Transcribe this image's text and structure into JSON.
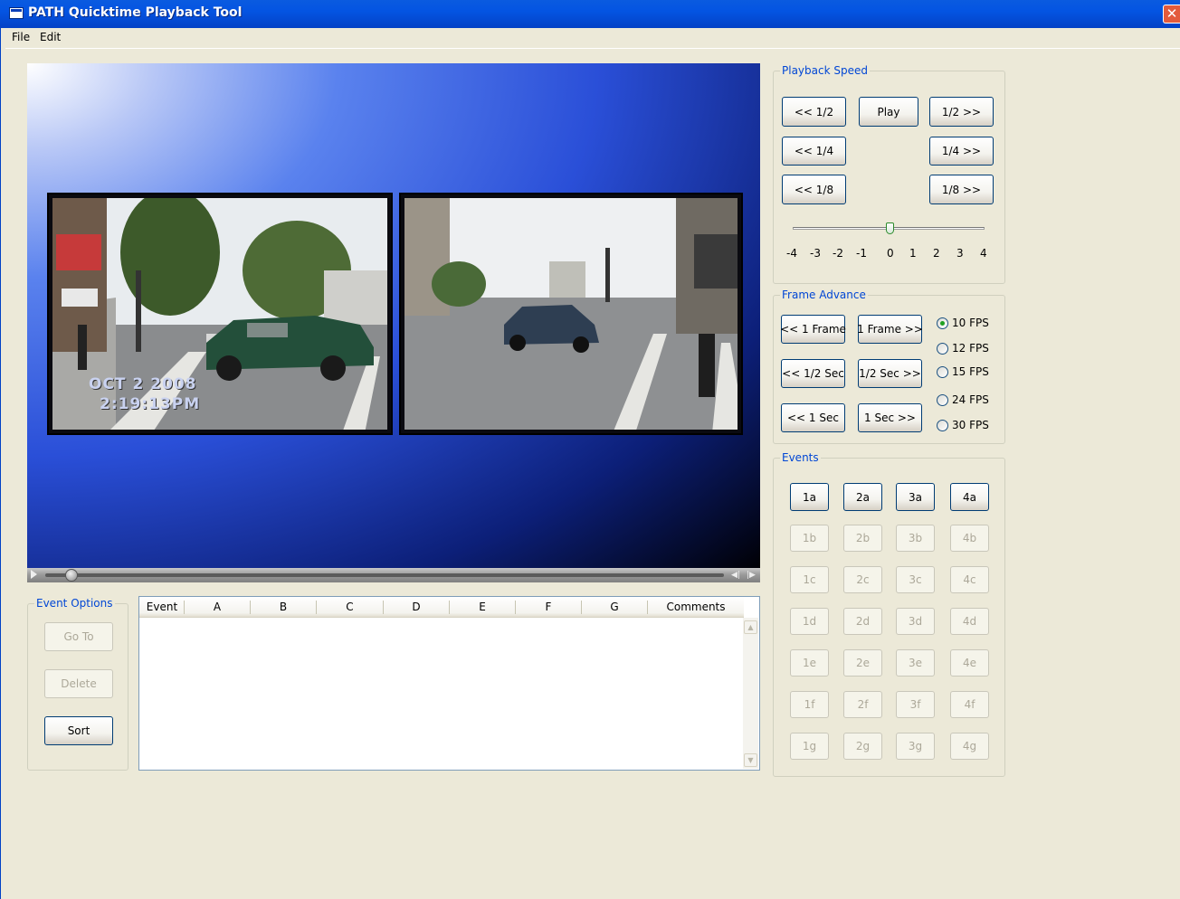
{
  "window": {
    "title": "PATH Quicktime Playback Tool",
    "close_glyph": "✕"
  },
  "menu": [
    "File",
    "Edit"
  ],
  "video": {
    "overlay_date": "OCT  2 2008",
    "overlay_time": "2:19:13PM"
  },
  "playback_speed": {
    "legend": "Playback Speed",
    "buttons": {
      "back_half": "<< 1/2",
      "play": "Play",
      "fwd_half": "1/2 >>",
      "back_quarter": "<< 1/4",
      "fwd_quarter": "1/4 >>",
      "back_eighth": "<< 1/8",
      "fwd_eighth": "1/8 >>"
    },
    "slider_value": 0,
    "tick_labels": [
      "-4",
      "-3",
      "-2",
      "-1",
      "0",
      "1",
      "2",
      "3",
      "4"
    ]
  },
  "frame_advance": {
    "legend": "Frame Advance",
    "buttons": {
      "back_frame": "<< 1 Frame",
      "fwd_frame": "1 Frame >>",
      "back_half_sec": "<< 1/2 Sec",
      "fwd_half_sec": "1/2 Sec >>",
      "back_sec": "<< 1 Sec",
      "fwd_sec": "1 Sec >>"
    },
    "fps_options": [
      "10 FPS",
      "12 FPS",
      "15 FPS",
      "24 FPS",
      "30 FPS"
    ],
    "fps_selected": "10 FPS"
  },
  "events": {
    "legend": "Events",
    "rows": [
      [
        "1a",
        "2a",
        "3a",
        "4a"
      ],
      [
        "1b",
        "2b",
        "3b",
        "4b"
      ],
      [
        "1c",
        "2c",
        "3c",
        "4c"
      ],
      [
        "1d",
        "2d",
        "3d",
        "4d"
      ],
      [
        "1e",
        "2e",
        "3e",
        "4e"
      ],
      [
        "1f",
        "2f",
        "3f",
        "4f"
      ],
      [
        "1g",
        "2g",
        "3g",
        "4g"
      ]
    ]
  },
  "event_options": {
    "legend": "Event Options",
    "goto": "Go To",
    "delete": "Delete",
    "sort": "Sort"
  },
  "event_table": {
    "columns": [
      "Event",
      "A",
      "B",
      "C",
      "D",
      "E",
      "F",
      "G",
      "Comments"
    ]
  },
  "colors": {
    "titlebar": "#0454E2",
    "legend_text": "#0046D5",
    "window_bg": "#ECE9D8",
    "button_border": "#003C74",
    "disabled_text": "#ACA899"
  }
}
